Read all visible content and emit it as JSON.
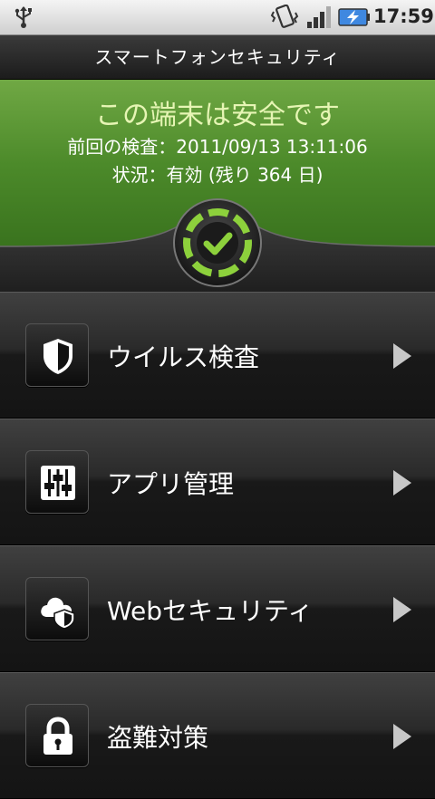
{
  "status_bar": {
    "time": "17:59",
    "icons": [
      "usb-icon",
      "vibrate-icon",
      "signal-icon",
      "battery-charging-icon"
    ]
  },
  "app": {
    "title": "スマートフォンセキュリティ"
  },
  "status_panel": {
    "headline": "この端末は安全です",
    "last_scan": "前回の検査：2011/09/13 13:11:06",
    "license_status": "状況：有効 (残り 364 日)",
    "accent_color": "#e6f5b4",
    "badge_icon": "check-icon"
  },
  "menu": {
    "items": [
      {
        "label": "ウイルス検査",
        "icon": "shield-icon"
      },
      {
        "label": "アプリ管理",
        "icon": "sliders-icon"
      },
      {
        "label": "Webセキュリティ",
        "icon": "cloud-shield-icon"
      },
      {
        "label": "盗難対策",
        "icon": "padlock-icon"
      }
    ]
  }
}
